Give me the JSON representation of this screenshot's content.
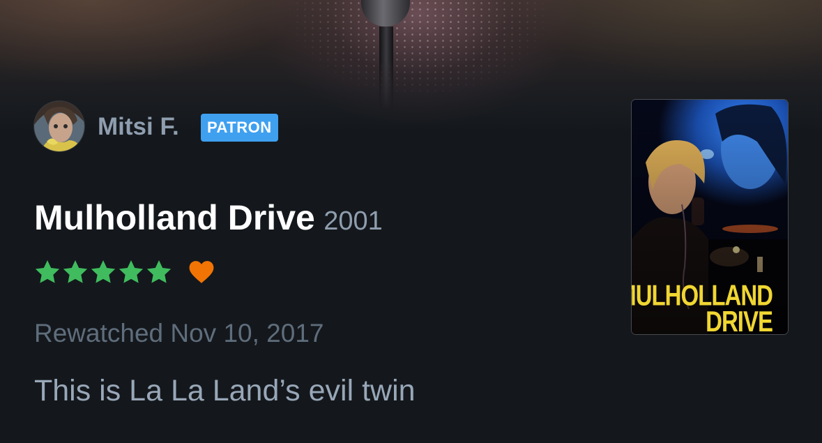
{
  "review": {
    "user": {
      "name": "Mitsi F.",
      "badge": "PATRON"
    },
    "film": {
      "title": "Mulholland Drive",
      "year": "2001",
      "poster_title_line1": "MULHOLLAND",
      "poster_title_line2": "DRIVE"
    },
    "rating": {
      "stars": 5,
      "max_stars": 5,
      "liked": true,
      "star_color": "#40bc5e",
      "heart_color": "#f27405"
    },
    "watched_text": "Rewatched Nov 10, 2017",
    "body": "This is La La Land’s evil twin"
  },
  "theme": {
    "background": "#14181c",
    "badge_color": "#3fa0f0",
    "muted_text": "#8f9eaf"
  },
  "icons": {
    "star": "star-icon",
    "heart": "heart-icon"
  }
}
